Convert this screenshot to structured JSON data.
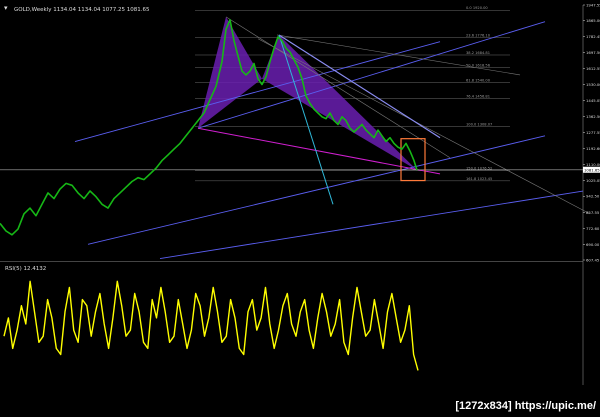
{
  "header": {
    "symbol_line": "GOLD,Weekly  1134.04 1134.04 1077.25 1081.65",
    "rsi_label": "RSI(5) 12.4132"
  },
  "watermark": "[1272x834] https://upic.me/",
  "colors": {
    "background": "#000000",
    "price": "#16b716",
    "rsi": "#ffff00",
    "harmonic_fill": "#6a1fb0",
    "trendline": "#5a5ef0",
    "magenta_line": "#d01fd0",
    "cyan_line": "#2fb8d8",
    "highlight_box": "#ff7a3a",
    "fib_line": "#6b6b6b",
    "axis": "#dddddd"
  },
  "chart_data": [
    {
      "type": "line",
      "name": "price",
      "y_ticks": [
        1947.55,
        1865.0,
        1782.45,
        1697.5,
        1612.55,
        1530.0,
        1445.05,
        1362.5,
        1277.55,
        1192.6,
        1110.0,
        1025.05,
        942.5,
        857.55,
        772.6,
        690.0,
        607.45
      ],
      "ylim": [
        607.45,
        1947.55
      ],
      "last_price": "1081.65",
      "points": [
        [
          0,
          800
        ],
        [
          6,
          760
        ],
        [
          12,
          740
        ],
        [
          18,
          770
        ],
        [
          24,
          850
        ],
        [
          30,
          880
        ],
        [
          36,
          840
        ],
        [
          42,
          900
        ],
        [
          48,
          960
        ],
        [
          54,
          930
        ],
        [
          60,
          980
        ],
        [
          66,
          1010
        ],
        [
          72,
          1000
        ],
        [
          78,
          960
        ],
        [
          84,
          930
        ],
        [
          90,
          970
        ],
        [
          96,
          940
        ],
        [
          102,
          900
        ],
        [
          108,
          880
        ],
        [
          114,
          930
        ],
        [
          120,
          960
        ],
        [
          126,
          990
        ],
        [
          132,
          1020
        ],
        [
          138,
          1040
        ],
        [
          144,
          1030
        ],
        [
          150,
          1060
        ],
        [
          156,
          1090
        ],
        [
          162,
          1130
        ],
        [
          168,
          1160
        ],
        [
          174,
          1190
        ],
        [
          180,
          1220
        ],
        [
          186,
          1260
        ],
        [
          192,
          1300
        ],
        [
          198,
          1340
        ],
        [
          204,
          1380
        ],
        [
          210,
          1450
        ],
        [
          216,
          1520
        ],
        [
          222,
          1650
        ],
        [
          226,
          1820
        ],
        [
          230,
          1870
        ],
        [
          234,
          1760
        ],
        [
          238,
          1680
        ],
        [
          242,
          1600
        ],
        [
          246,
          1580
        ],
        [
          250,
          1600
        ],
        [
          254,
          1640
        ],
        [
          258,
          1560
        ],
        [
          262,
          1530
        ],
        [
          266,
          1570
        ],
        [
          270,
          1650
        ],
        [
          274,
          1720
        ],
        [
          278,
          1780
        ],
        [
          282,
          1760
        ],
        [
          286,
          1720
        ],
        [
          290,
          1700
        ],
        [
          294,
          1660
        ],
        [
          298,
          1620
        ],
        [
          302,
          1560
        ],
        [
          306,
          1470
        ],
        [
          310,
          1430
        ],
        [
          314,
          1400
        ],
        [
          318,
          1380
        ],
        [
          322,
          1360
        ],
        [
          326,
          1350
        ],
        [
          330,
          1380
        ],
        [
          334,
          1340
        ],
        [
          338,
          1320
        ],
        [
          342,
          1360
        ],
        [
          346,
          1340
        ],
        [
          350,
          1300
        ],
        [
          354,
          1280
        ],
        [
          358,
          1300
        ],
        [
          362,
          1320
        ],
        [
          366,
          1290
        ],
        [
          370,
          1270
        ],
        [
          374,
          1250
        ],
        [
          378,
          1290
        ],
        [
          382,
          1260
        ],
        [
          386,
          1230
        ],
        [
          390,
          1250
        ],
        [
          394,
          1220
        ],
        [
          398,
          1200
        ],
        [
          402,
          1190
        ],
        [
          406,
          1220
        ],
        [
          410,
          1180
        ],
        [
          414,
          1130
        ],
        [
          417,
          1080
        ]
      ]
    },
    {
      "type": "line",
      "name": "rsi",
      "ylim": [
        0,
        100
      ],
      "values": [
        40,
        55,
        30,
        45,
        65,
        50,
        85,
        60,
        35,
        40,
        70,
        55,
        30,
        25,
        60,
        80,
        45,
        35,
        70,
        65,
        40,
        60,
        75,
        50,
        30,
        55,
        85,
        65,
        40,
        45,
        75,
        60,
        35,
        30,
        70,
        55,
        80,
        60,
        35,
        40,
        70,
        50,
        30,
        45,
        75,
        65,
        40,
        55,
        80,
        60,
        35,
        40,
        70,
        55,
        30,
        25,
        60,
        70,
        45,
        55,
        80,
        50,
        30,
        45,
        65,
        75,
        50,
        40,
        60,
        70,
        45,
        30,
        55,
        75,
        60,
        40,
        50,
        70,
        35,
        25,
        55,
        80,
        60,
        40,
        45,
        70,
        50,
        30,
        60,
        75,
        55,
        35,
        45,
        65,
        25,
        12
      ]
    }
  ],
  "annotations": {
    "fib_labels": [
      "0.0 1920.00",
      "23.6 1776.10",
      "38.2 1684.81",
      "50.0 1618.56",
      "61.8 1540.00",
      "76.4 1456.81",
      "100.0 1308.07",
      "150.0 1076.52",
      "161.8 1023.45"
    ],
    "fib_levels": [
      1920.0,
      1776.1,
      1684.81,
      1618.56,
      1540.0,
      1456.81,
      1308.07,
      1076.52,
      1023.45
    ],
    "harmonic": {
      "X": [
        198,
        1300
      ],
      "A": [
        226,
        1885
      ],
      "B": [
        262,
        1560
      ],
      "C": [
        279,
        1790
      ],
      "D": [
        417,
        1080
      ]
    }
  }
}
